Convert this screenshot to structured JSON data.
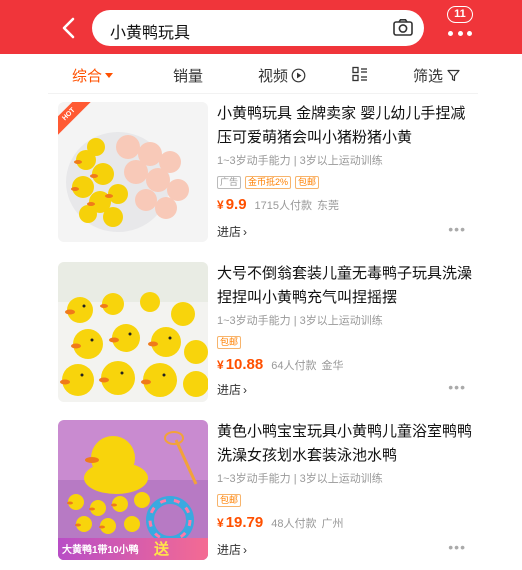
{
  "header": {
    "search_query": "小黄鸭玩具",
    "message_count": "11"
  },
  "sort_bar": {
    "comprehensive": "综合",
    "sales": "销量",
    "video": "视频",
    "filter": "筛选"
  },
  "products": [
    {
      "title": "小黄鸭玩具 金牌卖家 婴儿幼儿手捏减压可爱萌猪会叫小猪粉猪小黄",
      "meta": "1~3岁动手能力 | 3岁以上运动训练",
      "image_badge": "HOT",
      "tags": [
        "广告",
        "金币抵2%",
        "包邮"
      ],
      "currency": "¥",
      "price": "9.9",
      "sold": "1715人付款",
      "location": "东莞",
      "shop": "进店"
    },
    {
      "title": "大号不倒翁套装儿童无毒鸭子玩具洗澡捏捏叫小黄鸭充气叫捏摇摆",
      "meta": "1~3岁动手能力 | 3岁以上运动训练",
      "tags": [
        "包邮"
      ],
      "currency": "¥",
      "price": "10.88",
      "sold": "64人付款",
      "location": "金华",
      "shop": "进店"
    },
    {
      "title": "黄色小鸭宝宝玩具小黄鸭儿童浴室鸭鸭洗澡女孩划水套装泳池水鸭",
      "meta": "1~3岁动手能力 | 3岁以上运动训练",
      "tags": [
        "包邮"
      ],
      "currency": "¥",
      "price": "19.79",
      "sold": "48人付款",
      "location": "广州",
      "shop": "进店",
      "image_banner": "大黄鸭1带10小鸭",
      "image_banner_send": "送"
    }
  ],
  "colors": {
    "brand_red": "#f0353a",
    "accent_orange": "#ff5000"
  }
}
